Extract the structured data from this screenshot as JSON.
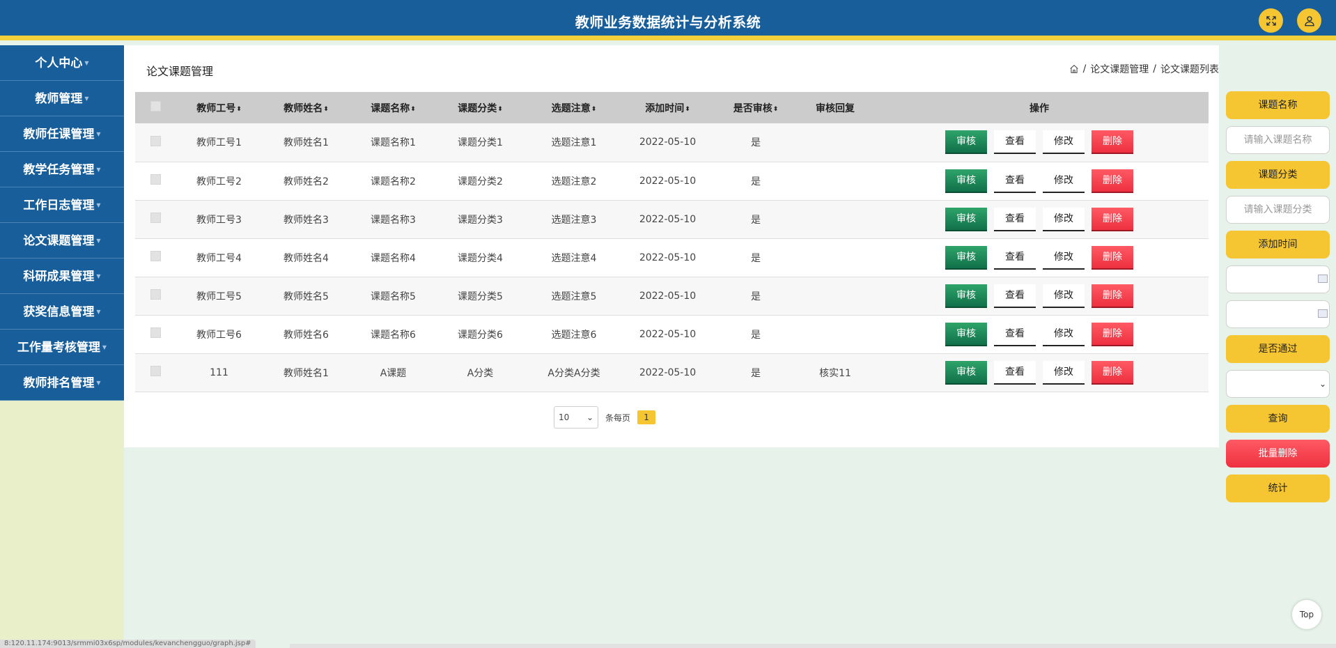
{
  "header": {
    "title": "教师业务数据统计与分析系统",
    "fullscreen_icon": "fullscreen-icon",
    "user_icon": "user-icon"
  },
  "sidebar": {
    "items": [
      {
        "label": "个人中心"
      },
      {
        "label": "教师管理"
      },
      {
        "label": "教师任课管理"
      },
      {
        "label": "教学任务管理"
      },
      {
        "label": "工作日志管理"
      },
      {
        "label": "论文课题管理"
      },
      {
        "label": "科研成果管理"
      },
      {
        "label": "获奖信息管理"
      },
      {
        "label": "工作量考核管理"
      },
      {
        "label": "教师排名管理"
      }
    ]
  },
  "page": {
    "title": "论文课题管理",
    "breadcrumb": [
      "论文课题管理",
      "论文课题列表"
    ],
    "breadcrumb_sep": "/"
  },
  "table": {
    "columns": [
      "教师工号",
      "教师姓名",
      "课题名称",
      "课题分类",
      "选题注意",
      "添加时间",
      "是否审核",
      "审核回复",
      "操作"
    ],
    "sortable": [
      true,
      true,
      true,
      true,
      true,
      true,
      true,
      false,
      false
    ],
    "rows": [
      {
        "teacher_no": "教师工号1",
        "teacher_name": "教师姓名1",
        "topic": "课题名称1",
        "category": "课题分类1",
        "note": "选题注意1",
        "added": "2022-05-10",
        "reviewed": "是",
        "reply": ""
      },
      {
        "teacher_no": "教师工号2",
        "teacher_name": "教师姓名2",
        "topic": "课题名称2",
        "category": "课题分类2",
        "note": "选题注意2",
        "added": "2022-05-10",
        "reviewed": "是",
        "reply": ""
      },
      {
        "teacher_no": "教师工号3",
        "teacher_name": "教师姓名3",
        "topic": "课题名称3",
        "category": "课题分类3",
        "note": "选题注意3",
        "added": "2022-05-10",
        "reviewed": "是",
        "reply": ""
      },
      {
        "teacher_no": "教师工号4",
        "teacher_name": "教师姓名4",
        "topic": "课题名称4",
        "category": "课题分类4",
        "note": "选题注意4",
        "added": "2022-05-10",
        "reviewed": "是",
        "reply": ""
      },
      {
        "teacher_no": "教师工号5",
        "teacher_name": "教师姓名5",
        "topic": "课题名称5",
        "category": "课题分类5",
        "note": "选题注意5",
        "added": "2022-05-10",
        "reviewed": "是",
        "reply": ""
      },
      {
        "teacher_no": "教师工号6",
        "teacher_name": "教师姓名6",
        "topic": "课题名称6",
        "category": "课题分类6",
        "note": "选题注意6",
        "added": "2022-05-10",
        "reviewed": "是",
        "reply": ""
      },
      {
        "teacher_no": "111",
        "teacher_name": "教师姓名1",
        "topic": "A课题",
        "category": "A分类",
        "note": "A分类A分类",
        "added": "2022-05-10",
        "reviewed": "是",
        "reply": "核实11"
      }
    ],
    "actions": {
      "audit": "审核",
      "view": "查看",
      "edit": "修改",
      "delete": "删除"
    }
  },
  "pagination": {
    "page_size": "10",
    "per_page_label": "条每页",
    "current_page": "1"
  },
  "search": {
    "topic_label": "课题名称",
    "topic_placeholder": "请输入课题名称",
    "category_label": "课题分类",
    "category_placeholder": "请输入课题分类",
    "time_label": "添加时间",
    "pass_label": "是否通过",
    "query_button": "查询",
    "batch_delete_button": "批量删除",
    "stats_button": "统计"
  },
  "top_button": "Top",
  "statusbar": "8:120.11.174:9013/srmmi03x6sp/modules/kevanchengguo/graph.jsp#"
}
